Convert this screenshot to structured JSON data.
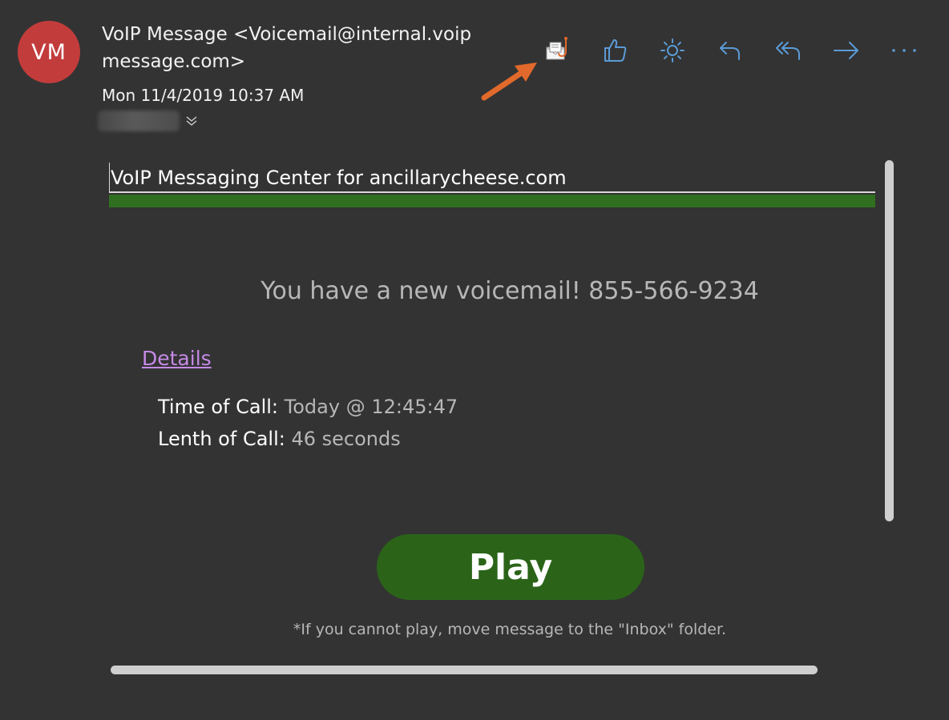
{
  "header": {
    "avatar_initials": "VM",
    "avatar_color": "#c33c3c",
    "sender": "VoIP Message <Voicemail@internal.voip message.com>",
    "date": "Mon 11/4/2019 10:37 AM"
  },
  "toolbar": {
    "accent_color": "#5b9bd5",
    "icons": [
      "report-phishing-icon",
      "like-icon",
      "brightness-icon",
      "reply-icon",
      "reply-all-icon",
      "forward-icon",
      "more-icon"
    ],
    "annotation_arrow_color": "#e0692b"
  },
  "message": {
    "title": "VoIP Messaging Center for ancillarycheese.com",
    "banner_color": "#2f6f1f",
    "headline": "You have a new voicemail! 855-566-9234",
    "details_link": "Details",
    "time_label": "Time of Call:",
    "time_value": "Today @ 12:45:47",
    "length_label": "Lenth of Call:",
    "length_value": "46 seconds",
    "play_label": "Play",
    "play_color": "#2b6419",
    "footnote": "*If you cannot play, move message to the \"Inbox\" folder."
  }
}
